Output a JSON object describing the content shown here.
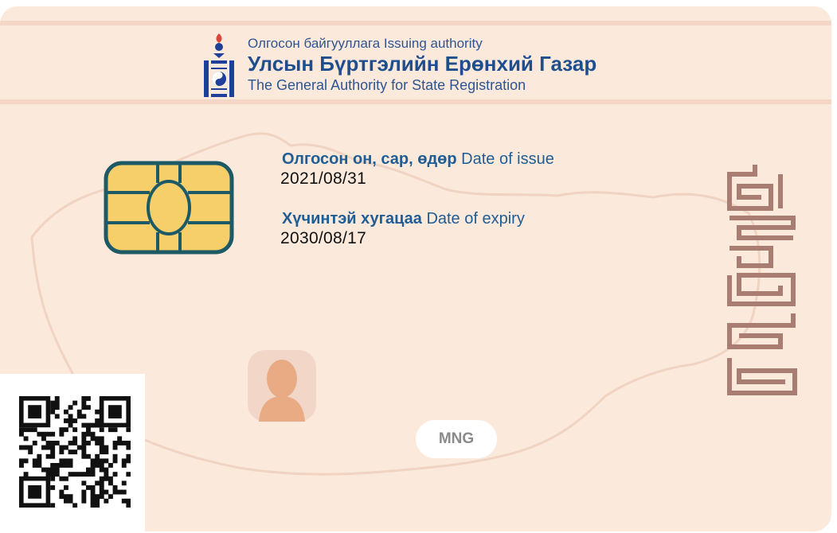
{
  "issuer": {
    "label": "Олгосон байгууллага Issuing authority",
    "name_mn": "Улсын Бүртгэлийн Ерөнхий Газар",
    "name_en": "The General Authority for State Registration"
  },
  "issue": {
    "label_mn": "Олгосон он, сар, өдөр",
    "label_en": "Date of issue",
    "value": "2021/08/31"
  },
  "expiry": {
    "label_mn": "Хүчинтэй хугацаа",
    "label_en": "Date of expiry",
    "value": "2030/08/17"
  },
  "country_code": "MNG",
  "icons": {
    "emblem": "soyombo-emblem-icon",
    "chip": "smart-chip-icon",
    "photo": "portrait-silhouette-icon",
    "script": "mongolian-script-seal",
    "qr": "qr-code"
  },
  "colors": {
    "card_background": "#fbe9dc",
    "heading_blue": "#1f4e8e",
    "chip_gold": "#f6cf6b",
    "chip_border": "#1d5a66",
    "script_brown": "#a97d72"
  }
}
